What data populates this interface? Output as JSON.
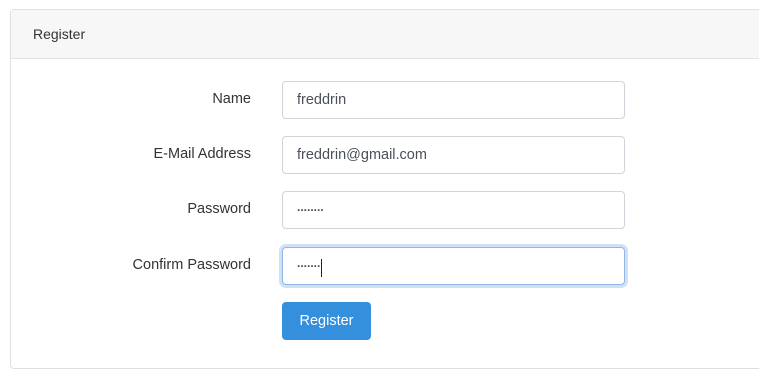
{
  "card": {
    "title": "Register"
  },
  "form": {
    "name": {
      "label": "Name",
      "value": "freddrin"
    },
    "email": {
      "label": "E-Mail Address",
      "value": "freddrin@gmail.com"
    },
    "password": {
      "label": "Password",
      "value": "........"
    },
    "confirm": {
      "label": "Confirm Password",
      "value": "......."
    },
    "submit_label": "Register"
  },
  "colors": {
    "primary": "#3490dc",
    "header_bg": "#f7f7f7",
    "border": "#dfdfdf",
    "focus": "#8fb8e8"
  }
}
